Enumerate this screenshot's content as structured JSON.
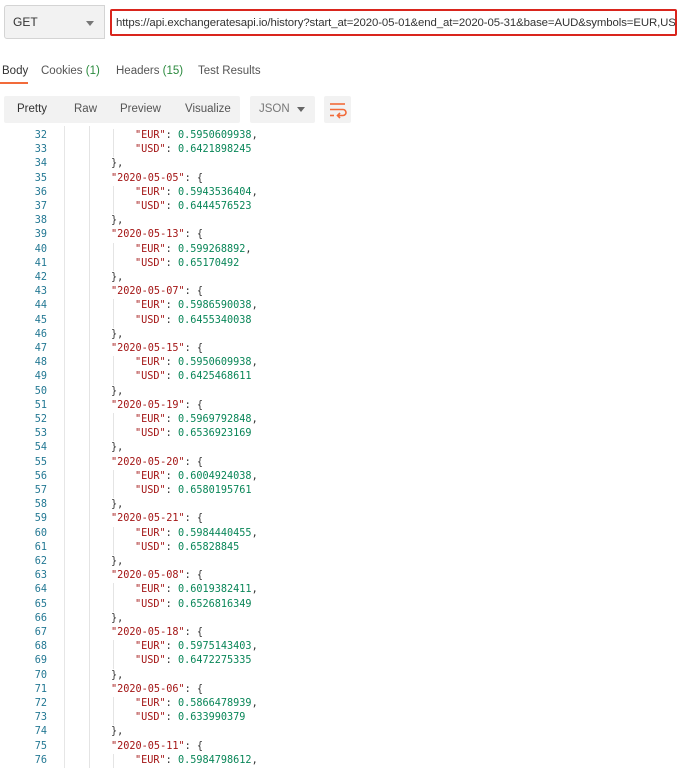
{
  "request": {
    "method": "GET",
    "url": "https://api.exchangeratesapi.io/history?start_at=2020-05-01&end_at=2020-05-31&base=AUD&symbols=EUR,USD"
  },
  "response_tabs": {
    "body": "Body",
    "cookies": "Cookies",
    "cookies_count": "(1)",
    "headers": "Headers",
    "headers_count": "(15)",
    "test_results": "Test Results"
  },
  "view_modes": {
    "pretty": "Pretty",
    "raw": "Raw",
    "preview": "Preview",
    "visualize": "Visualize",
    "format": "JSON"
  },
  "icons": {
    "method_dropdown": "chevron-down-icon",
    "format_dropdown": "chevron-down-icon",
    "wrap": "wrap-lines-icon"
  },
  "colors": {
    "url_highlight_border": "#d9251d",
    "active_tab_underline": "#f26b3a",
    "count_green": "#2b8a3e",
    "line_number": "#237893",
    "json_key": "#a31515",
    "json_number": "#098658"
  },
  "code_lines": [
    {
      "n": "32",
      "indent": 2,
      "key": "\"EUR\"",
      "value": "0.5950609938",
      "trail": ","
    },
    {
      "n": "33",
      "indent": 2,
      "key": "\"USD\"",
      "value": "0.6421898245",
      "trail": ""
    },
    {
      "n": "34",
      "indent": 1,
      "punc": "},"
    },
    {
      "n": "35",
      "indent": 1,
      "key": "\"2020-05-05\"",
      "open": true
    },
    {
      "n": "36",
      "indent": 2,
      "key": "\"EUR\"",
      "value": "0.5943536404",
      "trail": ","
    },
    {
      "n": "37",
      "indent": 2,
      "key": "\"USD\"",
      "value": "0.6444576523",
      "trail": ""
    },
    {
      "n": "38",
      "indent": 1,
      "punc": "},"
    },
    {
      "n": "39",
      "indent": 1,
      "key": "\"2020-05-13\"",
      "open": true
    },
    {
      "n": "40",
      "indent": 2,
      "key": "\"EUR\"",
      "value": "0.599268892",
      "trail": ","
    },
    {
      "n": "41",
      "indent": 2,
      "key": "\"USD\"",
      "value": "0.65170492",
      "trail": ""
    },
    {
      "n": "42",
      "indent": 1,
      "punc": "},"
    },
    {
      "n": "43",
      "indent": 1,
      "key": "\"2020-05-07\"",
      "open": true
    },
    {
      "n": "44",
      "indent": 2,
      "key": "\"EUR\"",
      "value": "0.5986590038",
      "trail": ","
    },
    {
      "n": "45",
      "indent": 2,
      "key": "\"USD\"",
      "value": "0.6455340038",
      "trail": ""
    },
    {
      "n": "46",
      "indent": 1,
      "punc": "},"
    },
    {
      "n": "47",
      "indent": 1,
      "key": "\"2020-05-15\"",
      "open": true
    },
    {
      "n": "48",
      "indent": 2,
      "key": "\"EUR\"",
      "value": "0.5950609938",
      "trail": ","
    },
    {
      "n": "49",
      "indent": 2,
      "key": "\"USD\"",
      "value": "0.6425468611",
      "trail": ""
    },
    {
      "n": "50",
      "indent": 1,
      "punc": "},"
    },
    {
      "n": "51",
      "indent": 1,
      "key": "\"2020-05-19\"",
      "open": true
    },
    {
      "n": "52",
      "indent": 2,
      "key": "\"EUR\"",
      "value": "0.5969792848",
      "trail": ","
    },
    {
      "n": "53",
      "indent": 2,
      "key": "\"USD\"",
      "value": "0.6536923169",
      "trail": ""
    },
    {
      "n": "54",
      "indent": 1,
      "punc": "},"
    },
    {
      "n": "55",
      "indent": 1,
      "key": "\"2020-05-20\"",
      "open": true
    },
    {
      "n": "56",
      "indent": 2,
      "key": "\"EUR\"",
      "value": "0.6004924038",
      "trail": ","
    },
    {
      "n": "57",
      "indent": 2,
      "key": "\"USD\"",
      "value": "0.6580195761",
      "trail": ""
    },
    {
      "n": "58",
      "indent": 1,
      "punc": "},"
    },
    {
      "n": "59",
      "indent": 1,
      "key": "\"2020-05-21\"",
      "open": true
    },
    {
      "n": "60",
      "indent": 2,
      "key": "\"EUR\"",
      "value": "0.5984440455",
      "trail": ","
    },
    {
      "n": "61",
      "indent": 2,
      "key": "\"USD\"",
      "value": "0.65828845",
      "trail": ""
    },
    {
      "n": "62",
      "indent": 1,
      "punc": "},"
    },
    {
      "n": "63",
      "indent": 1,
      "key": "\"2020-05-08\"",
      "open": true
    },
    {
      "n": "64",
      "indent": 2,
      "key": "\"EUR\"",
      "value": "0.6019382411",
      "trail": ","
    },
    {
      "n": "65",
      "indent": 2,
      "key": "\"USD\"",
      "value": "0.6526816349",
      "trail": ""
    },
    {
      "n": "66",
      "indent": 1,
      "punc": "},"
    },
    {
      "n": "67",
      "indent": 1,
      "key": "\"2020-05-18\"",
      "open": true
    },
    {
      "n": "68",
      "indent": 2,
      "key": "\"EUR\"",
      "value": "0.5975143403",
      "trail": ","
    },
    {
      "n": "69",
      "indent": 2,
      "key": "\"USD\"",
      "value": "0.6472275335",
      "trail": ""
    },
    {
      "n": "70",
      "indent": 1,
      "punc": "},"
    },
    {
      "n": "71",
      "indent": 1,
      "key": "\"2020-05-06\"",
      "open": true
    },
    {
      "n": "72",
      "indent": 2,
      "key": "\"EUR\"",
      "value": "0.5866478939",
      "trail": ","
    },
    {
      "n": "73",
      "indent": 2,
      "key": "\"USD\"",
      "value": "0.633990379",
      "trail": ""
    },
    {
      "n": "74",
      "indent": 1,
      "punc": "},"
    },
    {
      "n": "75",
      "indent": 1,
      "key": "\"2020-05-11\"",
      "open": true
    },
    {
      "n": "76",
      "indent": 2,
      "key": "\"EUR\"",
      "value": "0.5984798612",
      "trail": ","
    }
  ]
}
